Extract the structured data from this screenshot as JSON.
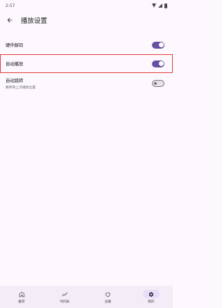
{
  "status_bar": {
    "time": "2:57"
  },
  "app_bar": {
    "title": "播放设置"
  },
  "settings": [
    {
      "label": "硬件解码",
      "sub": "",
      "enabled": true
    },
    {
      "label": "自动播放",
      "sub": "",
      "enabled": true
    },
    {
      "label": "自动跳转",
      "sub": "跳转到上次播放位置",
      "enabled": false
    }
  ],
  "bottom_nav": {
    "items": [
      {
        "label": "推荐",
        "icon": "home-icon",
        "active": false
      },
      {
        "label": "时间表",
        "icon": "trend-icon",
        "active": false
      },
      {
        "label": "追番",
        "icon": "heart-icon",
        "active": false
      },
      {
        "label": "我的",
        "icon": "gear-icon",
        "active": true
      }
    ]
  },
  "colors": {
    "accent": "#6750a4",
    "highlight": "#e03a3a"
  }
}
